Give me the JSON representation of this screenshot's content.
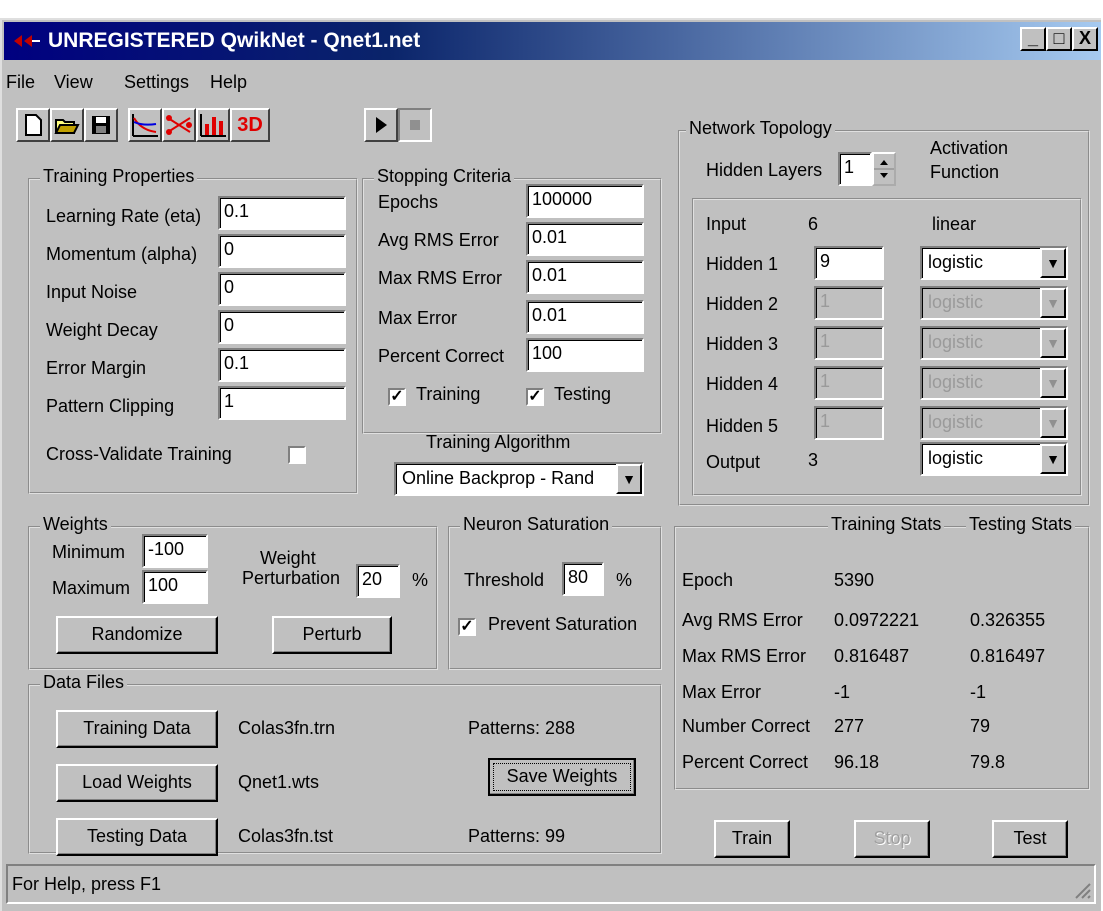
{
  "window": {
    "title": "UNREGISTERED QwikNet - Qnet1.net",
    "minimize": "_",
    "maximize": "□",
    "close": "X"
  },
  "menu": {
    "file": "File",
    "view": "View",
    "settings": "Settings",
    "help": "Help"
  },
  "toolbar": {
    "three_d": "3D"
  },
  "training_properties": {
    "title": "Training Properties",
    "learning_rate_label": "Learning Rate (eta)",
    "learning_rate": "0.1",
    "momentum_label": "Momentum (alpha)",
    "momentum": "0",
    "input_noise_label": "Input Noise",
    "input_noise": "0",
    "weight_decay_label": "Weight Decay",
    "weight_decay": "0",
    "error_margin_label": "Error Margin",
    "error_margin": "0.1",
    "pattern_clipping_label": "Pattern Clipping",
    "pattern_clipping": "1",
    "cross_validate_label": "Cross-Validate Training"
  },
  "stopping_criteria": {
    "title": "Stopping Criteria",
    "epochs_label": "Epochs",
    "epochs": "100000",
    "avg_rms_label": "Avg RMS Error",
    "avg_rms": "0.01",
    "max_rms_label": "Max RMS Error",
    "max_rms": "0.01",
    "max_error_label": "Max Error",
    "max_error": "0.01",
    "percent_correct_label": "Percent Correct",
    "percent_correct": "100",
    "training_label": "Training",
    "testing_label": "Testing"
  },
  "training_algorithm": {
    "label": "Training Algorithm",
    "value": "Online Backprop - Rand"
  },
  "topology": {
    "title": "Network Topology",
    "hidden_layers_label": "Hidden Layers",
    "hidden_layers": "1",
    "activation_label_1": "Activation",
    "activation_label_2": "Function",
    "input_label": "Input",
    "input_count": "6",
    "input_activation": "linear",
    "hidden": [
      {
        "label": "Hidden 1",
        "value": "9",
        "activation": "logistic"
      },
      {
        "label": "Hidden 2",
        "value": "1",
        "activation": "logistic"
      },
      {
        "label": "Hidden 3",
        "value": "1",
        "activation": "logistic"
      },
      {
        "label": "Hidden 4",
        "value": "1",
        "activation": "logistic"
      },
      {
        "label": "Hidden 5",
        "value": "1",
        "activation": "logistic"
      }
    ],
    "output_label": "Output",
    "output_count": "3",
    "output_activation": "logistic"
  },
  "weights": {
    "title": "Weights",
    "minimum_label": "Minimum",
    "minimum": "-100",
    "maximum_label": "Maximum",
    "maximum": "100",
    "perturb_label_1": "Weight",
    "perturb_label_2": "Perturbation",
    "perturb_value": "20",
    "percent": "%",
    "randomize": "Randomize",
    "perturb": "Perturb"
  },
  "saturation": {
    "title": "Neuron Saturation",
    "threshold_label": "Threshold",
    "threshold": "80",
    "percent": "%",
    "prevent_label": "Prevent Saturation"
  },
  "data_files": {
    "title": "Data Files",
    "training_button": "Training Data",
    "training_file": "Colas3fn.trn",
    "training_patterns": "Patterns: 288",
    "load_weights_button": "Load Weights",
    "weights_file": "Qnet1.wts",
    "save_weights_button": "Save Weights",
    "testing_button": "Testing Data",
    "testing_file": "Colas3fn.tst",
    "testing_patterns": "Patterns: 99"
  },
  "stats": {
    "training_header": "Training Stats",
    "testing_header": "Testing Stats",
    "rows": [
      {
        "label": "Epoch",
        "train": "5390",
        "test": ""
      },
      {
        "label": "Avg RMS Error",
        "train": "0.0972221",
        "test": "0.326355"
      },
      {
        "label": "Max RMS Error",
        "train": "0.816487",
        "test": "0.816497"
      },
      {
        "label": "Max Error",
        "train": "-1",
        "test": "-1"
      },
      {
        "label": "Number Correct",
        "train": "277",
        "test": "79"
      },
      {
        "label": "Percent Correct",
        "train": "96.18",
        "test": "79.8"
      }
    ]
  },
  "actions": {
    "train": "Train",
    "stop": "Stop",
    "test": "Test"
  },
  "status": {
    "text": "For Help, press F1"
  }
}
